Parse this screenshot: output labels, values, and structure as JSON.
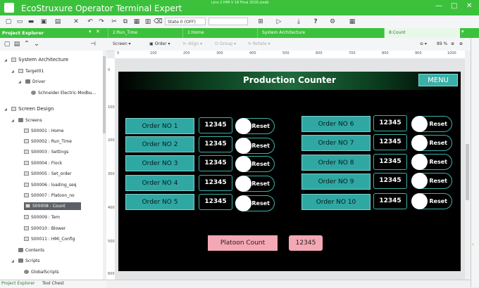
{
  "app": {
    "title": "EcoStruxure Operator Terminal Expert",
    "file_title": "Line 2 HMI V 18 Final 2026.xlsdb",
    "window_controls": [
      "—",
      "□",
      "✕"
    ]
  },
  "toolbar": {
    "state_select": "State 0 (OFF)",
    "icons": [
      "new-file-icon",
      "open-folder-icon",
      "save-icon",
      "delete-icon",
      "undo-icon",
      "redo-icon",
      "cut-icon",
      "copy-icon",
      "paste-icon",
      "trash-icon",
      "layout-icon",
      "run-icon",
      "download-icon",
      "help-icon",
      "grid-icon"
    ]
  },
  "explorer": {
    "header": "Project Explorer",
    "header_icons": [
      "pin-icon",
      "close-icon"
    ],
    "tree": {
      "system_architecture": "System Architecture",
      "target": "Target01",
      "driver": "Driver",
      "driver_item": "Schneider Electric-Modbu...",
      "screen_design": "Screen Design",
      "screens": "Screens",
      "screen_items": [
        "S00001 : Home",
        "S00002 : Run_Time",
        "S00003 : Settings",
        "S00004 : Flock",
        "S00005 : Set_order",
        "S00006 : loading_seq",
        "S00007 : Platoon_no",
        "S00008 : Count",
        "S00009 : Tem",
        "S00010 : Blower",
        "S00011 : HMI_Config"
      ],
      "selected_index": 7,
      "contents": "Contents",
      "scripts": "Scripts",
      "global_scripts": "GlobalScripts"
    },
    "bottom_tabs": [
      "Project Explorer",
      "Tool Chest"
    ]
  },
  "doc_tabs": [
    "2:Run_Time",
    "1:Home",
    "System Architecture",
    "8:Count"
  ],
  "doc_tabs_active_index": 3,
  "edit_toolbar": {
    "screen": "Screen",
    "order": "Order",
    "align": "Align",
    "group": "Group",
    "rotate": "Rotate",
    "zoom": "89 %"
  },
  "rulers": {
    "horizontal": [
      "0",
      "100",
      "200",
      "300",
      "400",
      "500",
      "600",
      "700",
      "800",
      "900",
      "1000"
    ],
    "vertical": [
      "0",
      "100",
      "200",
      "300",
      "400",
      "500",
      "600"
    ]
  },
  "hmi": {
    "title": "Production Counter",
    "menu": "MENU",
    "reset_label": "Reset",
    "left_orders": [
      {
        "label": "Order NO 1",
        "count": "12345"
      },
      {
        "label": "Order NO 2",
        "count": "12345"
      },
      {
        "label": "Order NO 3",
        "count": "12345"
      },
      {
        "label": "Order NO 4",
        "count": "12345"
      },
      {
        "label": "Order NO 5",
        "count": "12345"
      }
    ],
    "right_orders": [
      {
        "label": "Order NO 6",
        "count": "12345"
      },
      {
        "label": "Order NO 7",
        "count": "12345"
      },
      {
        "label": "Order NO 8",
        "count": "12345"
      },
      {
        "label": "Order NO 9",
        "count": "12345"
      },
      {
        "label": "Order NO 10",
        "count": "12345"
      }
    ],
    "platoon_label": "Platoon Count",
    "platoon_value": "12345"
  },
  "colors": {
    "accent_green": "#3cc13c",
    "teal_button": "#2fa8a4",
    "pink_display": "#f4a7b4"
  }
}
